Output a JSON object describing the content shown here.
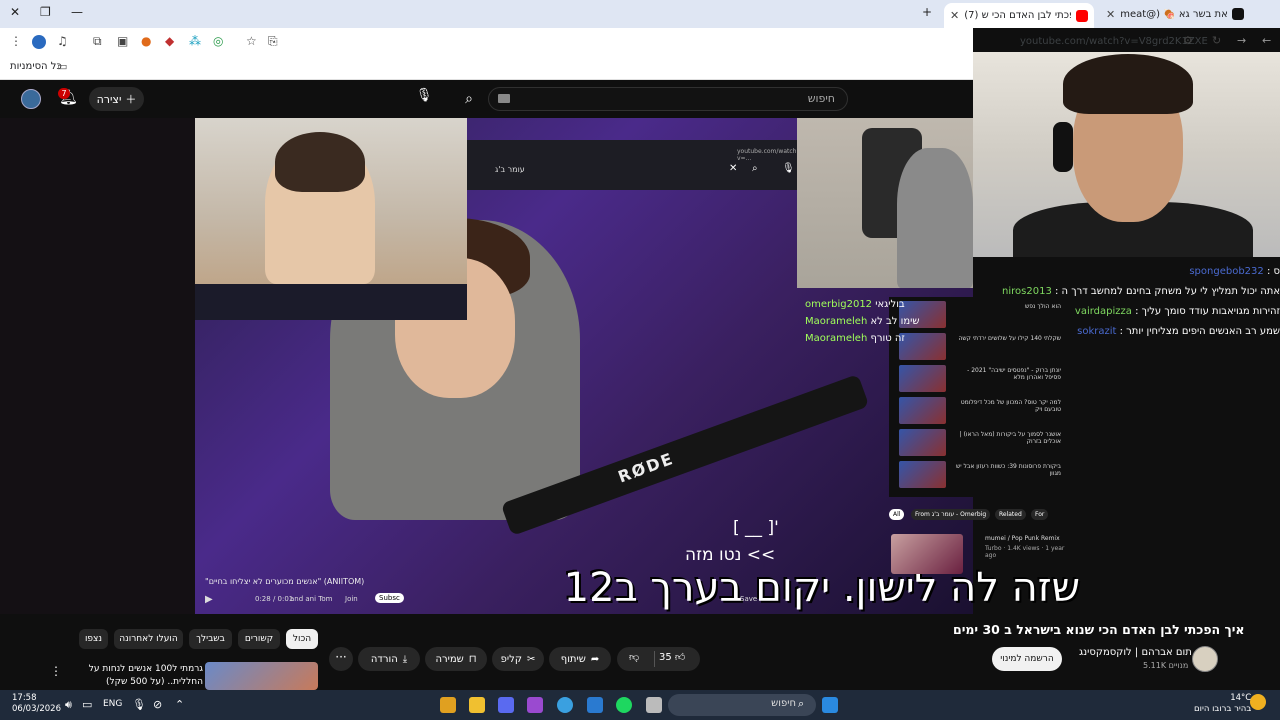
{
  "browser": {
    "tabs": [
      {
        "label": "(7) איך הפכתי לבן האדם הכי ש",
        "active": true
      },
      {
        "label": "meat@) 🍖 חושף את בשר גא",
        "active": false
      }
    ],
    "new_tab": "+",
    "close": "✕",
    "url": "youtube.com/watch?v=V8grd2K1ZXE",
    "bookmarks_label": "כל הסימניות"
  },
  "youtube": {
    "search_placeholder": "חיפוש",
    "create_label": "יצירה",
    "notification_count": "7",
    "video_title": "איך הפכתי לבן האדם הכי שנוא בישראל ב 30 ימים",
    "channel_name": "תום אברהם | לוקסמקסינג",
    "subscribers": "5.11K מנויים",
    "subscribe_label": "הרשמה למינוי",
    "like_count": "35",
    "share_label": "שיתוף",
    "clip_label": "קליפ",
    "save_label": "שמירה",
    "download_label": "הורדה",
    "more_label": "···",
    "filters": [
      "הכול",
      "קשורים",
      "בשבילך",
      "הועלו לאחרונה",
      "נצפו"
    ],
    "side_video_text": "גרמתי ל100 אנשים לנחות על החללית.. (על 500 שקל)"
  },
  "stream": {
    "inner_search": "עומר ב'ג",
    "inner_url": "youtube.com/watch?v=...",
    "caption_line1": "[ __ ]'",
    "caption_line2": "נטו מזה <<",
    "big_subtitle": "שזה לה לישון. יקום בערך ב12",
    "player_time": "0:28 / 0:01",
    "player_channel_hint": "and ani Tom",
    "player_join": "Join",
    "player_subscribe": "Subsc",
    "player_save": "Save",
    "player_video_title": "\"אנשים מכוערים לא יצליחו בחיים\" (ANIITOM)",
    "small_chat": [
      {
        "user": "omerbig2012",
        "text": "בוליגאי"
      },
      {
        "user": "Maorameleh",
        "text": "שימו לב לא"
      },
      {
        "user": "Maorameleh",
        "text": "זה טורף"
      }
    ],
    "recommended": [
      {
        "title": "הוא הולך נפש"
      },
      {
        "title": "שקלתי 140 קילו על שלושים ירדתי קשה"
      },
      {
        "title": "יונתן ברוק - \"נפטסים ישיבה\" 2021 - פסיפל ואהרון מלא"
      },
      {
        "title": "למה יקר טוס? המכוון של מכל דיפלומט טובעם ויק"
      },
      {
        "title": "אושנר לסמוך על ביקורות (מאל הראו) | אוכלים בזרוק"
      },
      {
        "title": "ביקורת פרוסונות 39: כשוות רעזון אבל יש מגוון"
      }
    ],
    "rec_chips": [
      "All",
      "From עומר ב'ג - Omerbig",
      "Related",
      "For"
    ],
    "mini_rec_title": "mumei / Pop Punk Remix",
    "mini_rec_meta": "Turbo · 1.4K views · 1 year ago"
  },
  "overlay_chat": [
    {
      "user": "spongebob232",
      "text": "ס"
    },
    {
      "user": "niros2013",
      "text": "אתה יכול תמליץ לי על משחק בחינם למחשב דרך ה"
    },
    {
      "user": "vairdapizza",
      "text": "זהירות מגויאבות עודד סומך עליך"
    },
    {
      "user": "sokrazit",
      "text": "שמע רב האנשים היפים מצליחין יותר"
    }
  ],
  "taskbar": {
    "time": "17:58",
    "date": "06/03/2026",
    "lang": "ENG",
    "search_label": "חיפוש",
    "temp": "14°C",
    "weather_text": "בהיר ברובו היום"
  }
}
